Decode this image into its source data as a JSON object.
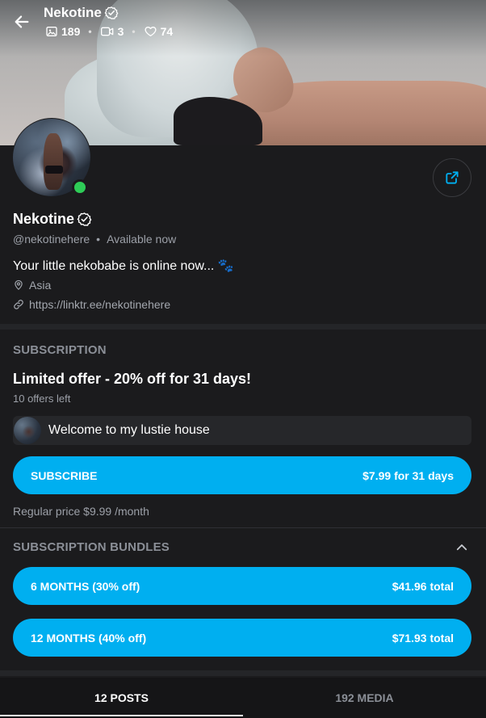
{
  "header": {
    "title": "Nekotine",
    "stats": {
      "photos": "189",
      "videos": "3",
      "likes": "74"
    }
  },
  "profile": {
    "name": "Nekotine",
    "handle": "@nekotinehere",
    "status": "Available now",
    "bio": "Your little nekobabe is online now... 🐾",
    "location": "Asia",
    "link": "https://linktr.ee/nekotinehere"
  },
  "subscription": {
    "section_title": "SUBSCRIPTION",
    "offer_title": "Limited offer - 20% off for 31 days!",
    "offers_left": "10 offers left",
    "welcome_message": "Welcome to my lustie house",
    "subscribe_label": "SUBSCRIBE",
    "subscribe_price": "$7.99 for 31 days",
    "regular_price": "Regular price $9.99 /month"
  },
  "bundles": {
    "section_title": "SUBSCRIPTION BUNDLES",
    "items": [
      {
        "label": "6 MONTHS (30% off)",
        "price": "$41.96 total"
      },
      {
        "label": "12 MONTHS (40% off)",
        "price": "$71.93 total"
      }
    ]
  },
  "tabs": [
    {
      "label": "12 POSTS",
      "active": true
    },
    {
      "label": "192 MEDIA",
      "active": false
    }
  ],
  "colors": {
    "accent": "#00aff0",
    "online": "#2ecc57",
    "background": "#1b1b1d"
  },
  "icons": {
    "back": "arrow-left-icon",
    "verified": "verified-badge-icon",
    "photos": "image-icon",
    "videos": "video-icon",
    "likes": "heart-icon",
    "share": "share-icon",
    "location": "location-pin-icon",
    "link": "link-icon",
    "collapse": "chevron-up-icon"
  }
}
